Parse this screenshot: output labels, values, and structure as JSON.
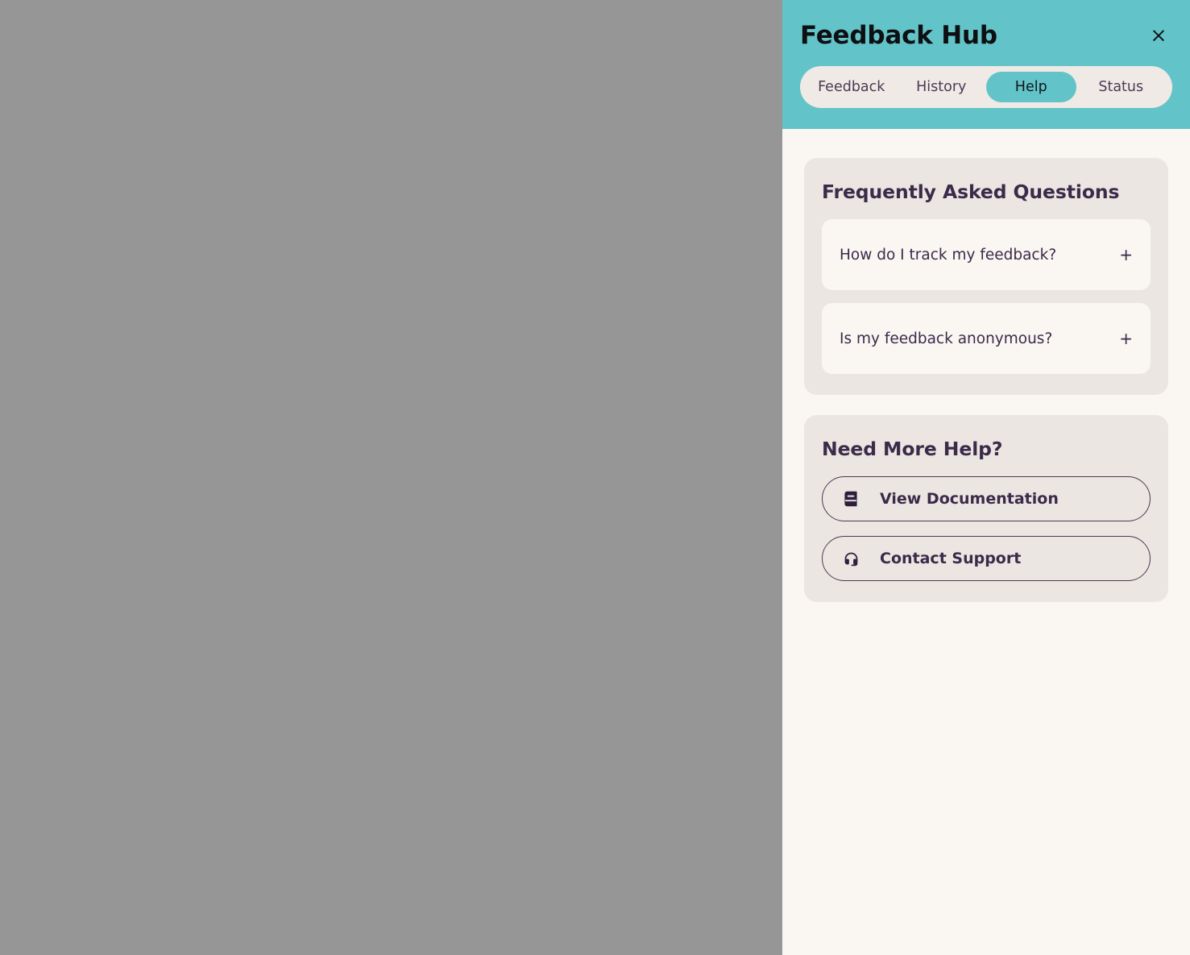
{
  "panel": {
    "title": "Feedback Hub",
    "close_label": "×",
    "accent_color": "#62c4c8",
    "panel_bg": "#faf6f2",
    "card_bg": "#ebe6e1",
    "text_color": "#3a2b4a",
    "backdrop_color": "#969696"
  },
  "tabs": [
    {
      "label": "Feedback",
      "active": false
    },
    {
      "label": "History",
      "active": false
    },
    {
      "label": "Help",
      "active": true
    },
    {
      "label": "Status",
      "active": false
    }
  ],
  "faq": {
    "title": "Frequently Asked Questions",
    "items": [
      {
        "question": "How do I track my feedback?",
        "toggle": "+"
      },
      {
        "question": "Is my feedback anonymous?",
        "toggle": "+"
      }
    ]
  },
  "more_help": {
    "title": "Need More Help?",
    "buttons": [
      {
        "label": "View Documentation",
        "icon": "book-icon"
      },
      {
        "label": "Contact Support",
        "icon": "headset-icon"
      }
    ]
  }
}
